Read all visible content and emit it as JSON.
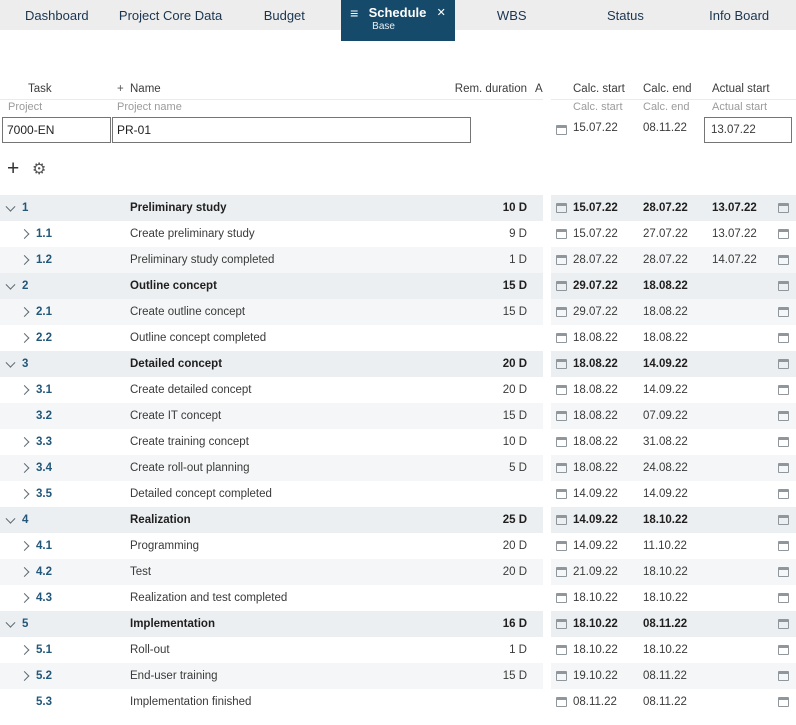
{
  "tab_bar": {
    "tabs": [
      {
        "label": "Dashboard",
        "active": false
      },
      {
        "label": "Project Core Data",
        "active": false
      },
      {
        "label": "Budget",
        "active": false
      },
      {
        "label": "Schedule",
        "active": true,
        "subtitle": "Base"
      },
      {
        "label": "WBS",
        "active": false
      },
      {
        "label": "Status",
        "active": false
      },
      {
        "label": "Info Board",
        "active": false
      }
    ]
  },
  "glyphs": {
    "menu": "≡",
    "close": "✕",
    "add": "+",
    "settings": "⚙",
    "column_add": "+"
  },
  "colors": {
    "accent": "#164a6b",
    "task_number": "#22577a",
    "parent_row": "#eceff1",
    "stripe_row": "#f4f6f7"
  },
  "table": {
    "headers": {
      "task": "Task",
      "name": "Name",
      "rem_duration": "Rem. duration",
      "a": "A",
      "calc_start": "Calc. start",
      "calc_end": "Calc. end",
      "actual_start": "Actual start"
    },
    "subheaders": {
      "project": "Project",
      "project_name": "Project name",
      "calc_start": "Calc. start",
      "calc_end": "Calc. end",
      "actual_start": "Actual start"
    }
  },
  "project_row": {
    "id": "7000-EN",
    "name": "PR-01",
    "calc_start": "15.07.22",
    "calc_end": "08.11.22",
    "actual_start": "13.07.22"
  },
  "tasks": [
    {
      "num": "1",
      "name": "Preliminary study",
      "duration": "10 D",
      "calc_start": "15.07.22",
      "calc_end": "28.07.22",
      "actual_start": "13.07.22",
      "level": 0,
      "chevron": "down"
    },
    {
      "num": "1.1",
      "name": "Create preliminary study",
      "duration": "9 D",
      "calc_start": "15.07.22",
      "calc_end": "27.07.22",
      "actual_start": "13.07.22",
      "level": 1,
      "chevron": "right"
    },
    {
      "num": "1.2",
      "name": "Preliminary study completed",
      "duration": "1 D",
      "calc_start": "28.07.22",
      "calc_end": "28.07.22",
      "actual_start": "14.07.22",
      "level": 1,
      "chevron": "right"
    },
    {
      "num": "2",
      "name": "Outline concept",
      "duration": "15 D",
      "calc_start": "29.07.22",
      "calc_end": "18.08.22",
      "actual_start": "",
      "level": 0,
      "chevron": "down"
    },
    {
      "num": "2.1",
      "name": "Create outline concept",
      "duration": "15 D",
      "calc_start": "29.07.22",
      "calc_end": "18.08.22",
      "actual_start": "",
      "level": 1,
      "chevron": "right"
    },
    {
      "num": "2.2",
      "name": "Outline concept completed",
      "duration": "",
      "calc_start": "18.08.22",
      "calc_end": "18.08.22",
      "actual_start": "",
      "level": 1,
      "chevron": "right"
    },
    {
      "num": "3",
      "name": "Detailed concept",
      "duration": "20 D",
      "calc_start": "18.08.22",
      "calc_end": "14.09.22",
      "actual_start": "",
      "level": 0,
      "chevron": "down"
    },
    {
      "num": "3.1",
      "name": "Create detailed concept",
      "duration": "20 D",
      "calc_start": "18.08.22",
      "calc_end": "14.09.22",
      "actual_start": "",
      "level": 1,
      "chevron": "right"
    },
    {
      "num": "3.2",
      "name": "Create IT concept",
      "duration": "15 D",
      "calc_start": "18.08.22",
      "calc_end": "07.09.22",
      "actual_start": "",
      "level": 1,
      "chevron": "none"
    },
    {
      "num": "3.3",
      "name": "Create training concept",
      "duration": "10 D",
      "calc_start": "18.08.22",
      "calc_end": "31.08.22",
      "actual_start": "",
      "level": 1,
      "chevron": "right"
    },
    {
      "num": "3.4",
      "name": "Create roll-out planning",
      "duration": "5 D",
      "calc_start": "18.08.22",
      "calc_end": "24.08.22",
      "actual_start": "",
      "level": 1,
      "chevron": "right"
    },
    {
      "num": "3.5",
      "name": "Detailed concept completed",
      "duration": "",
      "calc_start": "14.09.22",
      "calc_end": "14.09.22",
      "actual_start": "",
      "level": 1,
      "chevron": "right"
    },
    {
      "num": "4",
      "name": "Realization",
      "duration": "25 D",
      "calc_start": "14.09.22",
      "calc_end": "18.10.22",
      "actual_start": "",
      "level": 0,
      "chevron": "down"
    },
    {
      "num": "4.1",
      "name": "Programming",
      "duration": "20 D",
      "calc_start": "14.09.22",
      "calc_end": "11.10.22",
      "actual_start": "",
      "level": 1,
      "chevron": "right"
    },
    {
      "num": "4.2",
      "name": "Test",
      "duration": "20 D",
      "calc_start": "21.09.22",
      "calc_end": "18.10.22",
      "actual_start": "",
      "level": 1,
      "chevron": "right"
    },
    {
      "num": "4.3",
      "name": "Realization and test completed",
      "duration": "",
      "calc_start": "18.10.22",
      "calc_end": "18.10.22",
      "actual_start": "",
      "level": 1,
      "chevron": "right"
    },
    {
      "num": "5",
      "name": "Implementation",
      "duration": "16 D",
      "calc_start": "18.10.22",
      "calc_end": "08.11.22",
      "actual_start": "",
      "level": 0,
      "chevron": "down"
    },
    {
      "num": "5.1",
      "name": "Roll-out",
      "duration": "1 D",
      "calc_start": "18.10.22",
      "calc_end": "18.10.22",
      "actual_start": "",
      "level": 1,
      "chevron": "right"
    },
    {
      "num": "5.2",
      "name": "End-user training",
      "duration": "15 D",
      "calc_start": "19.10.22",
      "calc_end": "08.11.22",
      "actual_start": "",
      "level": 1,
      "chevron": "right"
    },
    {
      "num": "5.3",
      "name": "Implementation finished",
      "duration": "",
      "calc_start": "08.11.22",
      "calc_end": "08.11.22",
      "actual_start": "",
      "level": 1,
      "chevron": "none"
    }
  ]
}
